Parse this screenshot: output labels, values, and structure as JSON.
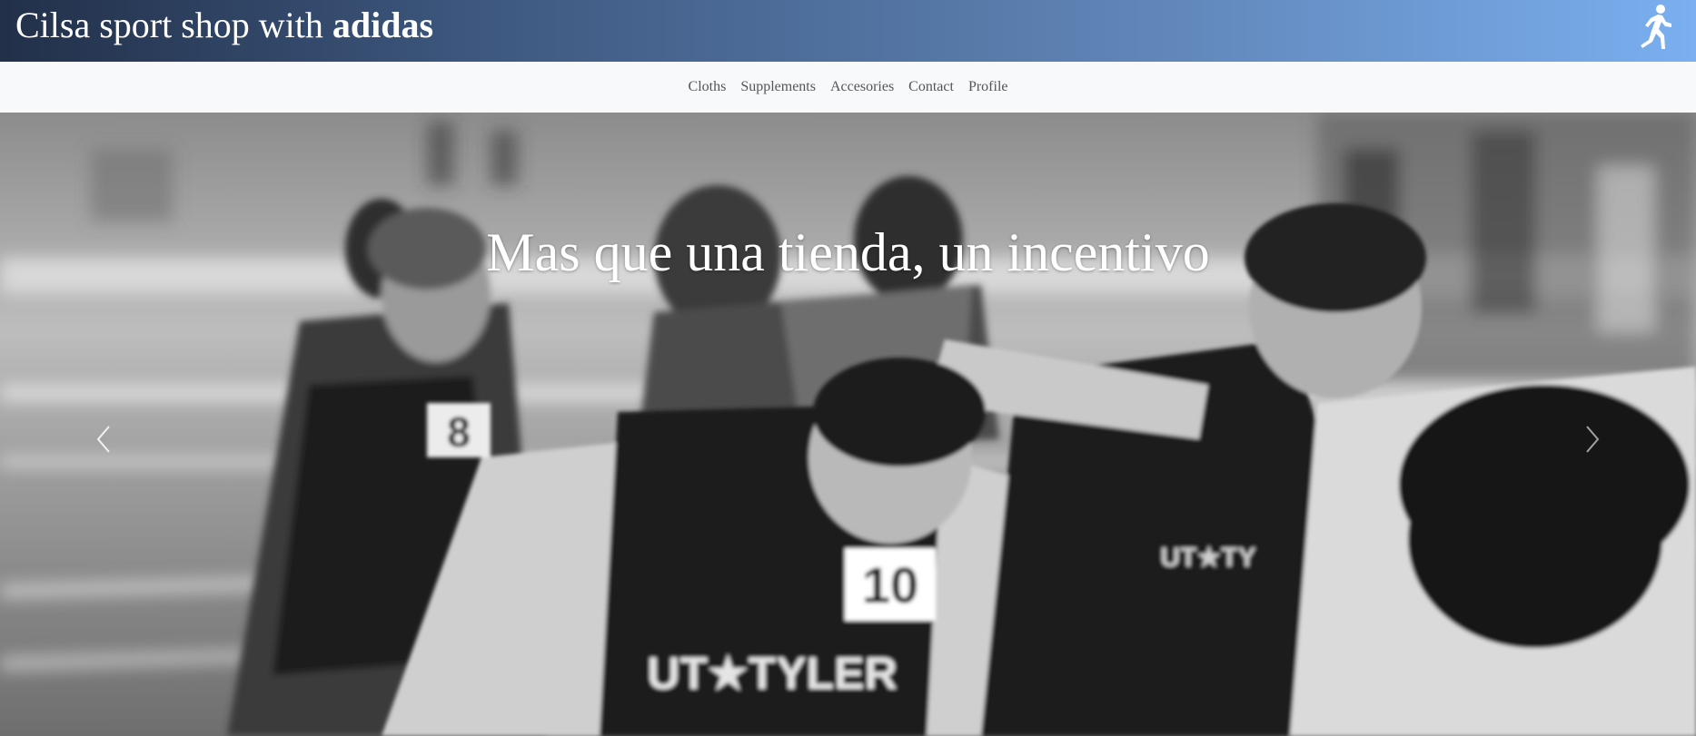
{
  "header": {
    "brand_prefix": "Cilsa sport shop with ",
    "brand_bold": "adidas",
    "icon": "runner-icon",
    "gradient": [
      "#223049",
      "#7aaff0"
    ]
  },
  "nav": {
    "items": [
      {
        "label": "Cloths"
      },
      {
        "label": "Supplements"
      },
      {
        "label": "Accesories"
      },
      {
        "label": "Contact"
      },
      {
        "label": "Profile"
      }
    ]
  },
  "hero": {
    "caption": "Mas que una tienda, un incentivo",
    "image_description_icon": "runners-photo",
    "prev_icon": "chevron-left-icon",
    "next_icon": "chevron-right-icon"
  }
}
